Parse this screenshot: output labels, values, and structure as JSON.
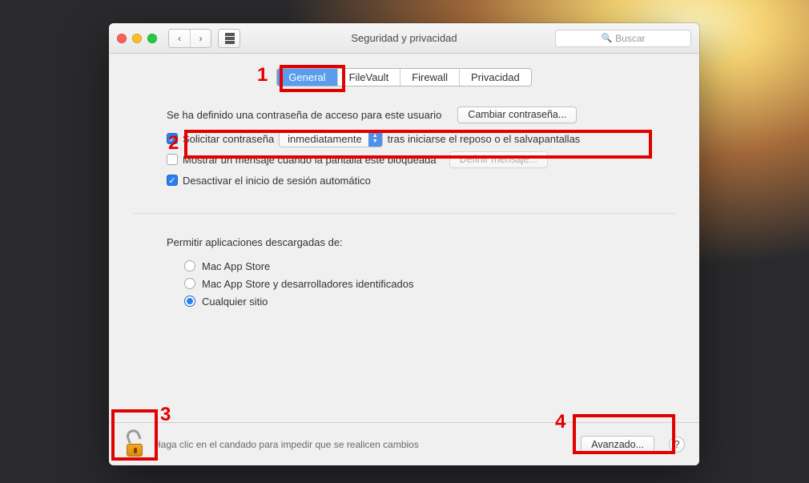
{
  "toolbar": {
    "title": "Seguridad y privacidad",
    "search_placeholder": "Buscar"
  },
  "tabs": {
    "general": "General",
    "filevault": "FileVault",
    "firewall": "Firewall",
    "privacy": "Privacidad"
  },
  "general": {
    "password_defined": "Se ha definido una contraseña de acceso para este usuario",
    "change_password_btn": "Cambiar contraseña...",
    "require_password_prefix": "Solicitar contraseña",
    "require_password_delay": "inmediatamente",
    "require_password_suffix": "tras iniciarse el reposo o el salvapantallas",
    "show_lock_message": "Mostrar un mensaje cuando la pantalla esté bloqueada",
    "set_lock_message_btn": "Definir mensaje...",
    "disable_autologin": "Desactivar el inicio de sesión automático",
    "allow_apps_title": "Permitir aplicaciones descargadas de:",
    "opt_appstore": "Mac App Store",
    "opt_devs": "Mac App Store y desarrolladores identificados",
    "opt_anywhere": "Cualquier sitio"
  },
  "footer": {
    "lock_hint": "Haga clic en el candado para impedir que se realicen cambios",
    "advanced_btn": "Avanzado..."
  },
  "annotations": {
    "n1": "1",
    "n2": "2",
    "n3": "3",
    "n4": "4"
  }
}
